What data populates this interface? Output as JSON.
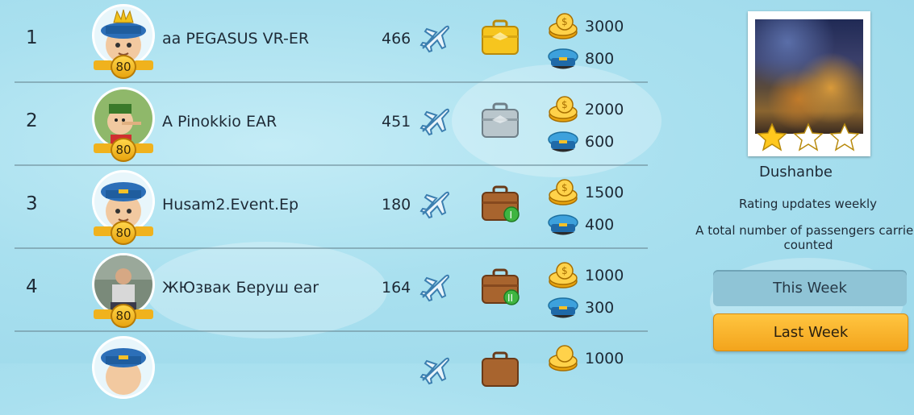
{
  "leaderboard": {
    "rows": [
      {
        "rank": "1",
        "name": "aa PEGASUS VR-ER",
        "level": "80",
        "flights": "466",
        "badge": "gold-briefcase-icon",
        "coins": "3000",
        "caps": "800"
      },
      {
        "rank": "2",
        "name": "A Pinokkio EAR",
        "level": "80",
        "flights": "451",
        "badge": "silver-briefcase-icon",
        "coins": "2000",
        "caps": "600"
      },
      {
        "rank": "3",
        "name": "Husam2.Event.Ep",
        "level": "80",
        "flights": "180",
        "badge": "leather-briefcase-I-icon",
        "coins": "1500",
        "caps": "400"
      },
      {
        "rank": "4",
        "name": "ЖЮзвак Беруш ear",
        "level": "80",
        "flights": "164",
        "badge": "leather-briefcase-II-icon",
        "coins": "1000",
        "caps": "300"
      },
      {
        "rank": "",
        "name": "",
        "level": "",
        "flights": "",
        "badge": "leather-briefcase-icon",
        "coins": "1000",
        "caps": ""
      }
    ]
  },
  "sidebar": {
    "city": "Dushanbe",
    "stars_filled": 1,
    "stars_total": 3,
    "rating_note": "Rating updates weekly",
    "passengers_note": "A total number of passengers carried counted",
    "tabs": {
      "this_week": "This Week",
      "last_week": "Last Week"
    }
  }
}
